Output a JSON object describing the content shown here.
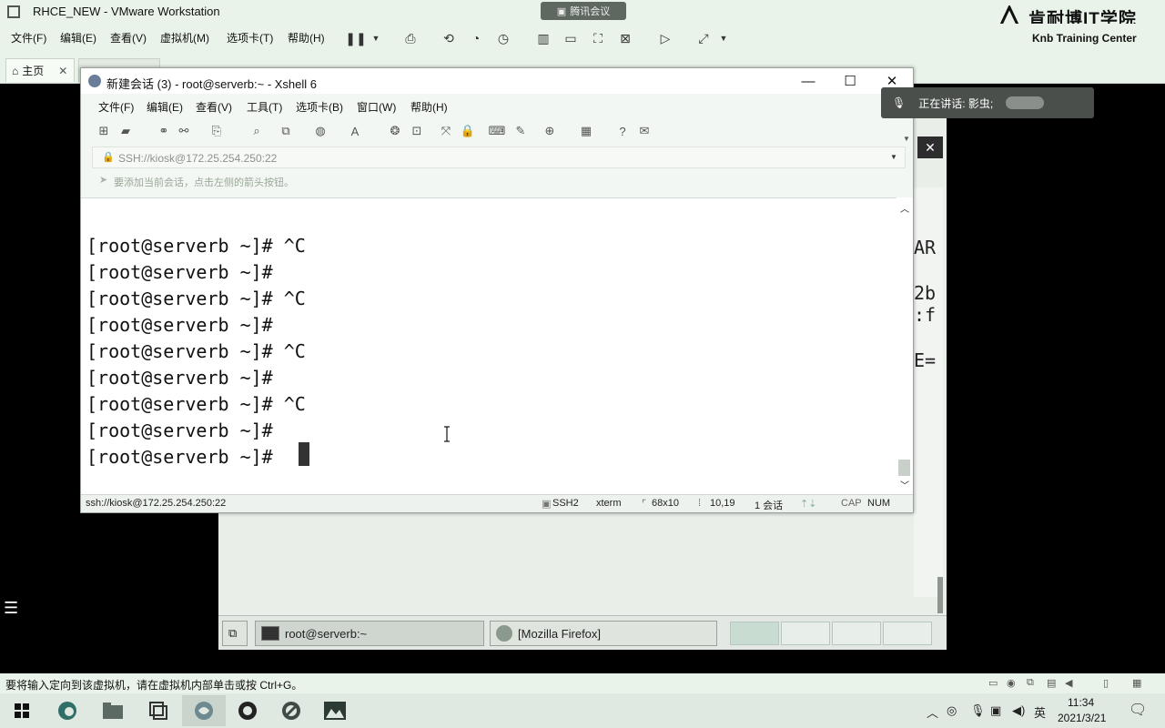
{
  "vmware": {
    "title": "RHCE_NEW - VMware Workstation",
    "menu": [
      "文件(F)",
      "编辑(E)",
      "查看(V)",
      "虚拟机(M)",
      "选项卡(T)",
      "帮助(H)"
    ],
    "home_tab": "主页",
    "meeting_badge": "腾讯会议",
    "logo_title": "肯耐博IT学院",
    "logo_sub": "Knb Training Center",
    "status_text": "要将输入定向到该虚拟机，请在虚拟机内部单击或按 Ctrl+G。"
  },
  "speaking": {
    "label": "正在讲话: 影虫;"
  },
  "xshell": {
    "title": "新建会话 (3) - root@serverb:~ - Xshell 6",
    "menu": [
      "文件(F)",
      "编辑(E)",
      "查看(V)",
      "工具(T)",
      "选项卡(B)",
      "窗口(W)",
      "帮助(H)"
    ],
    "address": "SSH://kiosk@172.25.254.250:22",
    "tip": "要添加当前会话，点击左侧的箭头按钮。",
    "terminal_lines": [
      "[root@serverb ~]# ^C",
      "[root@serverb ~]#",
      "[root@serverb ~]# ^C",
      "[root@serverb ~]#",
      "[root@serverb ~]# ^C",
      "[root@serverb ~]#",
      "[root@serverb ~]# ^C",
      "[root@serverb ~]#",
      "[root@serverb ~]# "
    ],
    "status": {
      "connection": "ssh://kiosk@172.25.254.250:22",
      "protocol": "SSH2",
      "term": "xterm",
      "size": "68x10",
      "cursor_pos": "10,19",
      "sessions": "1 会话",
      "cap": "CAP",
      "num": "NUM"
    }
  },
  "guest": {
    "side_chars": [
      "AR",
      "2b",
      ":f",
      "E="
    ],
    "taskbar_terminal": "root@serverb:~",
    "taskbar_firefox": "[Mozilla Firefox]"
  },
  "win_taskbar": {
    "ime": "英",
    "time": "11:34",
    "date": "2021/3/21"
  },
  "colors": {
    "vmware_bg": "#eaf3ea",
    "terminal_bg": "#ffffff",
    "terminal_fg": "#111111"
  }
}
